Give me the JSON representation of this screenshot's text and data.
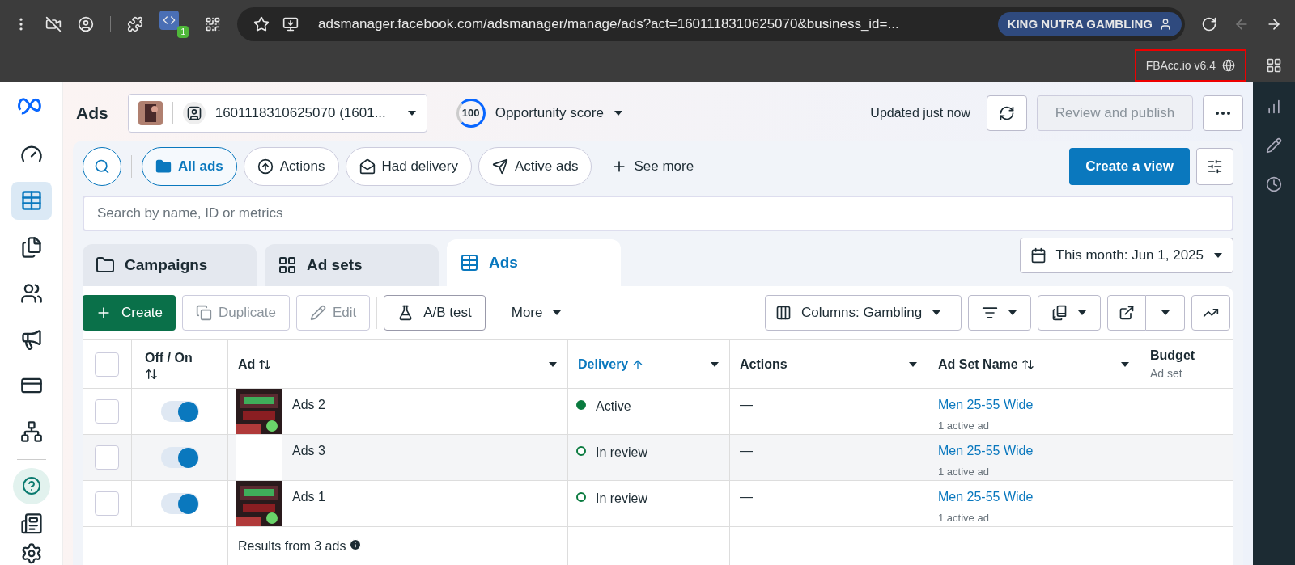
{
  "browser": {
    "extension_badge": "1",
    "url": "adsmanager.facebook.com/adsmanager/manage/ads?act=1601118310625070&business_id=...",
    "profile": "KING NUTRA GAMBLING",
    "back_disabled": true,
    "extension_label": "FBAcc.io v6.4"
  },
  "nav_items": [
    {
      "selected": false
    },
    {
      "selected": true
    },
    {
      "selected": false
    },
    {
      "selected": false
    },
    {
      "selected": false
    },
    {
      "selected": false
    },
    {
      "selected": false
    }
  ],
  "header": {
    "title": "Ads",
    "account": "1601118310625070 (1601...",
    "score": "100",
    "score_label": "Opportunity score",
    "updated": "Updated just now",
    "publish": {
      "label": "Review and publish",
      "disabled": true
    }
  },
  "filters": [
    {
      "label": "All ads",
      "selected": true,
      "kind": "folder"
    },
    {
      "label": "Actions",
      "selected": false,
      "kind": "actions"
    },
    {
      "label": "Had delivery",
      "selected": false,
      "kind": "mail"
    },
    {
      "label": "Active ads",
      "selected": false,
      "kind": "send"
    }
  ],
  "see_more": "See more",
  "create_view": "Create a view",
  "search": {
    "placeholder": "Search by name, ID or metrics"
  },
  "tabs": [
    {
      "label": "Campaigns",
      "selected": false
    },
    {
      "label": "Ad sets",
      "selected": false
    },
    {
      "label": "Ads",
      "selected": true
    }
  ],
  "date_range": "This month: Jun 1, 2025",
  "toolbar": {
    "create": "Create",
    "duplicate": {
      "label": "Duplicate",
      "disabled": true
    },
    "edit": {
      "label": "Edit",
      "disabled": true
    },
    "ab_test": "A/B test",
    "more": "More",
    "columns": "Columns: Gambling"
  },
  "table": {
    "all_checked": false,
    "columns": [
      {
        "label": "Off / On",
        "kind": "sortable"
      },
      {
        "label": "Ad",
        "kind": "sortable"
      },
      {
        "label": "Delivery",
        "kind": "sorted"
      },
      {
        "label": "Actions",
        "kind": "plain"
      },
      {
        "label": "Ad Set Name",
        "kind": "sortable"
      },
      {
        "label": "Budget",
        "sub": "Ad set",
        "kind": "plain"
      }
    ],
    "rows": [
      {
        "checked": false,
        "on": true,
        "ad": "Ads 2",
        "has_thumbnail": true,
        "delivery": "Active",
        "active": true,
        "actions": "—",
        "ad_set": "Men 25-55 Wide",
        "ad_set_sub": "1 active ad"
      },
      {
        "checked": false,
        "on": true,
        "ad": "Ads 3",
        "has_thumbnail": false,
        "delivery": "In review",
        "active": false,
        "actions": "—",
        "ad_set": "Men 25-55 Wide",
        "ad_set_sub": "1 active ad"
      },
      {
        "checked": false,
        "on": true,
        "ad": "Ads 1",
        "has_thumbnail": true,
        "delivery": "In review",
        "active": false,
        "actions": "—",
        "ad_set": "Men 25-55 Wide",
        "ad_set_sub": "1 active ad"
      }
    ],
    "footer": "Results from 3 ads"
  }
}
